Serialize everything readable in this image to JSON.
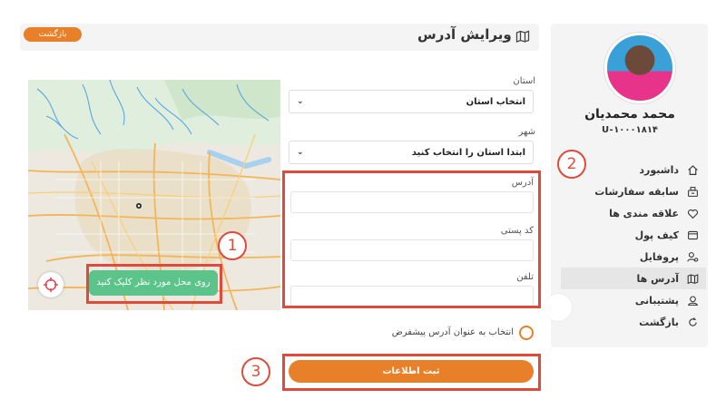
{
  "header": {
    "title": "ویرایش آدرس",
    "back_label": "بازگشت"
  },
  "profile": {
    "name": "محمد محمدیان",
    "user_id": "U-۱۰۰۰۱۸۱۴"
  },
  "sidebar": {
    "items": [
      {
        "label": "داشبورد",
        "icon": "home-icon"
      },
      {
        "label": "سابقه سفارشات",
        "icon": "orders-icon"
      },
      {
        "label": "علاقه مندی ها",
        "icon": "heart-icon"
      },
      {
        "label": "کیف پول",
        "icon": "wallet-icon"
      },
      {
        "label": "پروفایل",
        "icon": "user-settings-icon"
      },
      {
        "label": "آدرس ها",
        "icon": "map-icon",
        "active": true
      },
      {
        "label": "پشتیبانی",
        "icon": "support-icon"
      },
      {
        "label": "بازگشت",
        "icon": "return-icon"
      }
    ]
  },
  "map": {
    "pill_label": "روی محل مورد نظر کلیک کنید",
    "locate_icon": "target-icon"
  },
  "form": {
    "province_label": "استان",
    "province_value": "انتخاب استان",
    "city_label": "شهر",
    "city_value": "ابتدا استان را انتخاب کنید",
    "address_label": "آدرس",
    "address_value": "",
    "postal_label": "کد پستی",
    "postal_value": "",
    "phone_label": "تلفن",
    "phone_value": "",
    "default_label": "انتخاب به عنوان آدرس پیشفرض",
    "default_checked": false,
    "submit_label": "ثبت اطلاعات"
  },
  "annotations": [
    "1",
    "2",
    "3"
  ],
  "colors": {
    "accent": "#e8802a",
    "annotation": "#e04a3a",
    "map_pill": "#5cc48a"
  }
}
